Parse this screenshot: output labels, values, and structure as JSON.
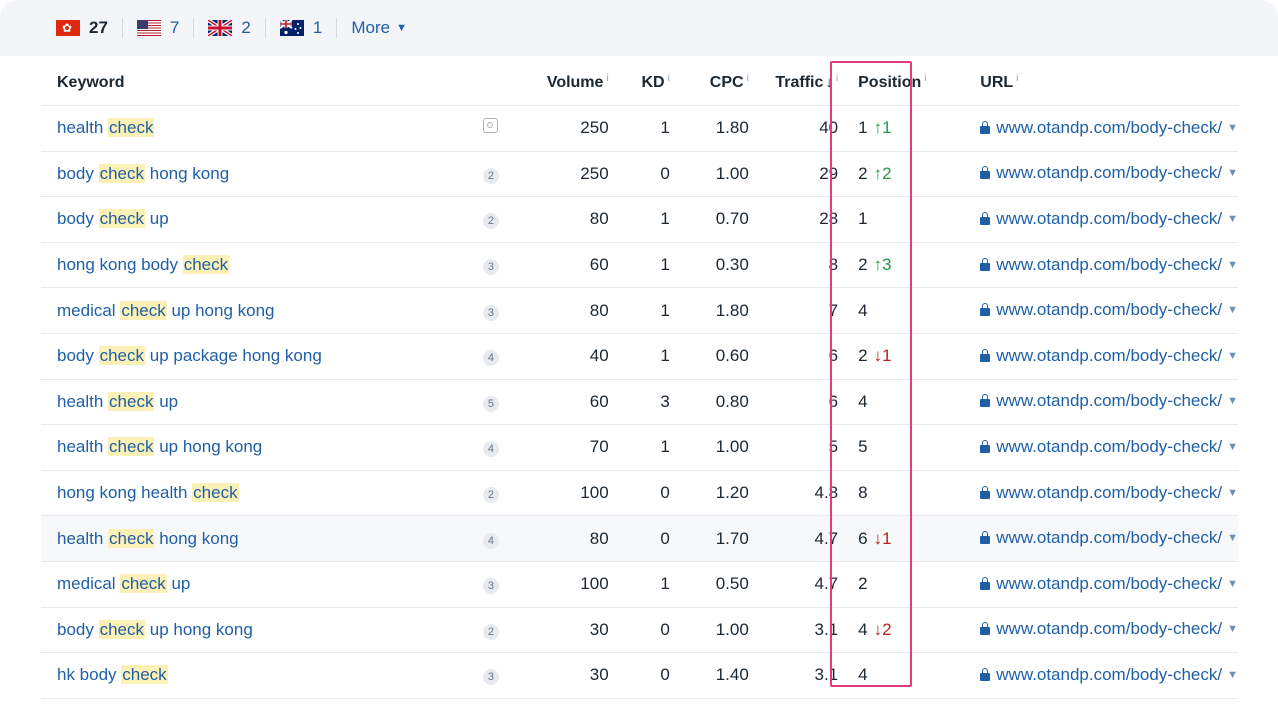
{
  "countries": [
    {
      "flag": "hk-flag-icon",
      "count": "27",
      "active": true
    },
    {
      "flag": "us-flag-icon",
      "count": "7",
      "active": false
    },
    {
      "flag": "gb-flag-icon",
      "count": "2",
      "active": false
    },
    {
      "flag": "au-flag-icon",
      "count": "1",
      "active": false
    }
  ],
  "more_label": "More",
  "columns": {
    "keyword": "Keyword",
    "volume": "Volume",
    "kd": "KD",
    "cpc": "CPC",
    "traffic": "Traffic",
    "position": "Position",
    "url": "URL",
    "info_mark": "i"
  },
  "colors": {
    "accent": "#1f5fa6",
    "highlight_box": "#e33b7d",
    "up": "#1f9d40",
    "down": "#b3261e",
    "keyword_highlight": "#fbf0b6"
  },
  "highlight_term": "check",
  "rows": [
    {
      "keyword": "health check",
      "badge": "serp-icon",
      "volume": "250",
      "kd": "1",
      "cpc": "1.80",
      "traffic": "40",
      "position": "1",
      "change": "↑1",
      "change_dir": "up",
      "url": "www.otandp.com/body-check/"
    },
    {
      "keyword": "body check hong kong",
      "badge": "2",
      "volume": "250",
      "kd": "0",
      "cpc": "1.00",
      "traffic": "29",
      "position": "2",
      "change": "↑2",
      "change_dir": "up",
      "url": "www.otandp.com/body-check/"
    },
    {
      "keyword": "body check up",
      "badge": "2",
      "volume": "80",
      "kd": "1",
      "cpc": "0.70",
      "traffic": "28",
      "position": "1",
      "change": "",
      "change_dir": "",
      "url": "www.otandp.com/body-check/"
    },
    {
      "keyword": "hong kong body check",
      "badge": "3",
      "volume": "60",
      "kd": "1",
      "cpc": "0.30",
      "traffic": "8",
      "position": "2",
      "change": "↑3",
      "change_dir": "up",
      "url": "www.otandp.com/body-check/"
    },
    {
      "keyword": "medical check up hong kong",
      "badge": "3",
      "volume": "80",
      "kd": "1",
      "cpc": "1.80",
      "traffic": "7",
      "position": "4",
      "change": "",
      "change_dir": "",
      "url": "www.otandp.com/body-check/"
    },
    {
      "keyword": "body check up package hong kong",
      "badge": "4",
      "volume": "40",
      "kd": "1",
      "cpc": "0.60",
      "traffic": "6",
      "position": "2",
      "change": "↓1",
      "change_dir": "down",
      "url": "www.otandp.com/body-check/"
    },
    {
      "keyword": "health check up",
      "badge": "5",
      "volume": "60",
      "kd": "3",
      "cpc": "0.80",
      "traffic": "6",
      "position": "4",
      "change": "",
      "change_dir": "",
      "url": "www.otandp.com/body-check/"
    },
    {
      "keyword": "health check up hong kong",
      "badge": "4",
      "volume": "70",
      "kd": "1",
      "cpc": "1.00",
      "traffic": "5",
      "position": "5",
      "change": "",
      "change_dir": "",
      "url": "www.otandp.com/body-check/"
    },
    {
      "keyword": "hong kong health check",
      "badge": "2",
      "volume": "100",
      "kd": "0",
      "cpc": "1.20",
      "traffic": "4.8",
      "position": "8",
      "change": "",
      "change_dir": "",
      "url": "www.otandp.com/body-check/"
    },
    {
      "keyword": "health check hong kong",
      "badge": "4",
      "volume": "80",
      "kd": "0",
      "cpc": "1.70",
      "traffic": "4.7",
      "position": "6",
      "change": "↓1",
      "change_dir": "down",
      "url": "www.otandp.com/body-check/",
      "hover": true
    },
    {
      "keyword": "medical check up",
      "badge": "3",
      "volume": "100",
      "kd": "1",
      "cpc": "0.50",
      "traffic": "4.7",
      "position": "2",
      "change": "",
      "change_dir": "",
      "url": "www.otandp.com/body-check/"
    },
    {
      "keyword": "body check up hong kong",
      "badge": "2",
      "volume": "30",
      "kd": "0",
      "cpc": "1.00",
      "traffic": "3.1",
      "position": "4",
      "change": "↓2",
      "change_dir": "down",
      "url": "www.otandp.com/body-check/"
    },
    {
      "keyword": "hk body check",
      "badge": "3",
      "volume": "30",
      "kd": "0",
      "cpc": "1.40",
      "traffic": "3.1",
      "position": "4",
      "change": "",
      "change_dir": "",
      "url": "www.otandp.com/body-check/"
    }
  ]
}
